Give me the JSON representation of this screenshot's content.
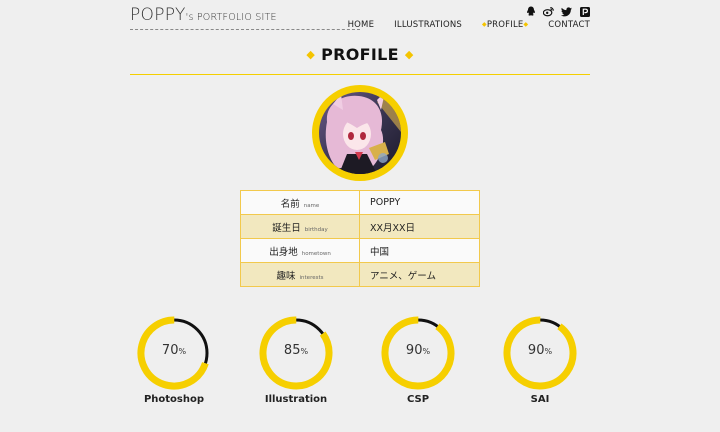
{
  "header": {
    "logo_main": "POPPY",
    "logo_sub": "'s PORTFOLIO SITE",
    "nav": [
      {
        "label": "HOME"
      },
      {
        "label": "ILLUSTRATIONS"
      },
      {
        "label": "PROFILE"
      },
      {
        "label": "CONTACT"
      }
    ],
    "social": [
      "qq-icon",
      "weibo-icon",
      "twitter-icon",
      "pixiv-icon"
    ]
  },
  "page": {
    "title": "PROFILE"
  },
  "profile": {
    "rows": [
      {
        "label": "名前",
        "label_en": "name",
        "value": "POPPY"
      },
      {
        "label": "誕生日",
        "label_en": "birthday",
        "value": "XX月XX日"
      },
      {
        "label": "出身地",
        "label_en": "hometown",
        "value": "中国"
      },
      {
        "label": "趣味",
        "label_en": "interests",
        "value": "アニメ、ゲーム"
      }
    ]
  },
  "skills": [
    {
      "name": "Photoshop",
      "value": "70",
      "unit": "%",
      "fraction": 0.7
    },
    {
      "name": "Illustration",
      "value": "85",
      "unit": "%",
      "fraction": 0.85
    },
    {
      "name": "CSP",
      "value": "90",
      "unit": "%",
      "fraction": 0.9
    },
    {
      "name": "SAI",
      "value": "90",
      "unit": "%",
      "fraction": 0.9
    }
  ],
  "colors": {
    "accent": "#f6cf00",
    "ring_track": "#111111",
    "table_border": "#f2c94c",
    "table_alt": "#f2e8bf"
  }
}
